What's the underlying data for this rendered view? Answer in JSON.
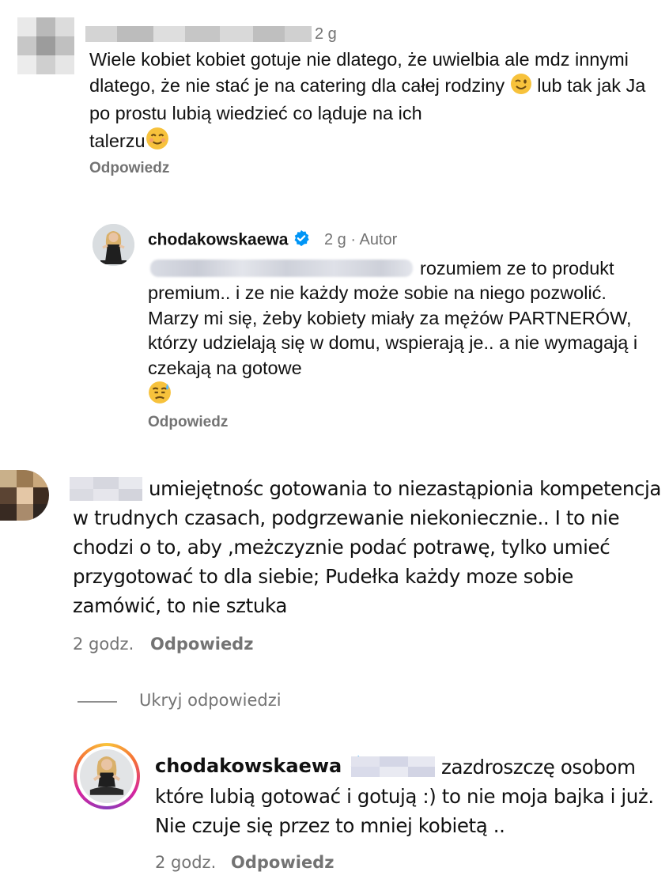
{
  "comments": [
    {
      "time": "2 g",
      "text": "Wiele kobiet kobiet gotuje nie dlatego, że uwielbia ale mdz innymi dlatego, że nie stać je na catering dla całej rodziny",
      "text_line3_rest": " lub tak jak Ja po prostu lubią wiedzieć co ląduje na ich",
      "text_line4": "talerzu",
      "emoji1": "wink-emoji",
      "emoji2": "smile-emoji",
      "reply_label": "Odpowiedz"
    },
    {
      "username": "chodakowskaewa",
      "time": "2 g · Autor",
      "text_line1": "rozumiem ze to produkt",
      "text_rest": "premium.. i ze nie każdy może sobie na niego pozwolić. Marzy mi się, żeby kobiety miały za mężów PARTNERÓW, którzy udzielają się w domu, wspierają je.. a nie wymagają i czekają na gotowe",
      "emoji": "sweat-emoji",
      "reply_label": "Odpowiedz"
    },
    {
      "text_line1": "umiejętnośc gotowania to niezastąpionia kompetencja",
      "text_rest": "w trudnych czasach, podgrzewanie niekoniecznie.. I to nie chodzi o to, aby ,meżczyznie podać potrawę, tylko umieć przygotować to dla siebie; Pudełka każdy moze sobie zamówić, to nie sztuka",
      "time": "2 godz.",
      "reply_label": "Odpowiedz"
    },
    {
      "hide_replies_label": "Ukryj odpowiedzi"
    },
    {
      "username": "chodakowskaewa",
      "text_line1": "zazdroszczę osobom",
      "text_rest": "które lubią gotować i gotują :) to nie moja bajka i już. Nie czuje się przez to mniej kobietą ..",
      "time": "2 godz.",
      "reply_label": "Odpowiedz"
    }
  ],
  "colors": {
    "text": "#111111",
    "muted": "#737373",
    "verified": "#0095f6"
  }
}
